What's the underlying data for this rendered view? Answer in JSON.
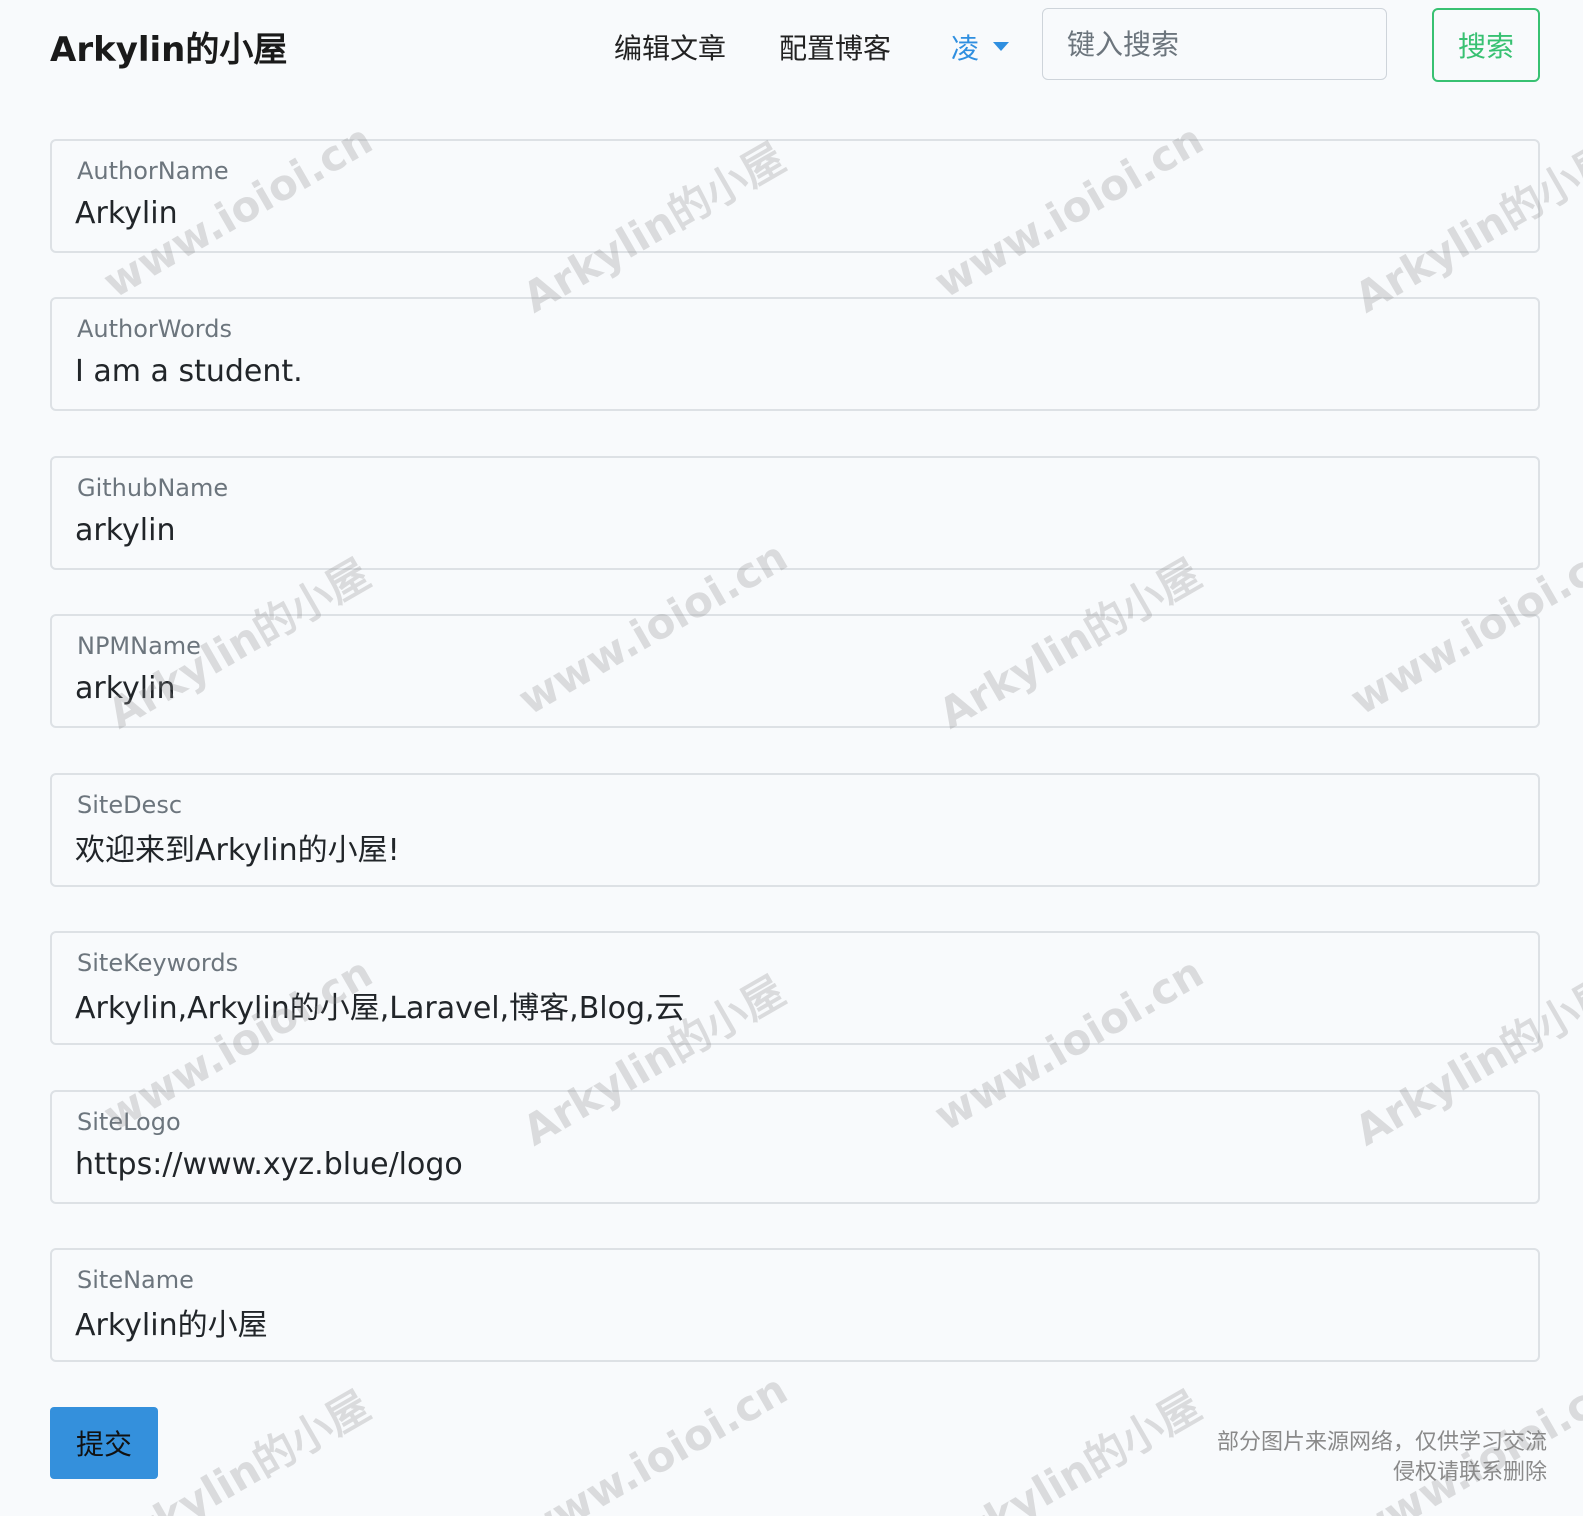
{
  "navbar": {
    "brand": "Arkylin的小屋",
    "links": [
      {
        "label": "编辑文章"
      },
      {
        "label": "配置博客"
      }
    ],
    "user_menu": "凌",
    "search": {
      "placeholder": "键入搜索",
      "button_label": "搜索"
    }
  },
  "form": {
    "fields": [
      {
        "label": "AuthorName",
        "value": "Arkylin"
      },
      {
        "label": "AuthorWords",
        "value": "I am a student."
      },
      {
        "label": "GithubName",
        "value": "arkylin"
      },
      {
        "label": "NPMName",
        "value": "arkylin"
      },
      {
        "label": "SiteDesc",
        "value": "欢迎来到Arkylin的小屋!"
      },
      {
        "label": "SiteKeywords",
        "value": "Arkylin,Arkylin的小屋,Laravel,博客,Blog,云"
      },
      {
        "label": "SiteLogo",
        "value": "https://www.xyz.blue/logo"
      },
      {
        "label": "SiteName",
        "value": "Arkylin的小屋"
      }
    ],
    "submit_label": "提交"
  },
  "footnote": {
    "line1": "部分图片来源网络，仅供学习交流",
    "line2": "侵权请联系删除"
  },
  "watermark": {
    "site": "www.ioioi.cn",
    "name": "Arkylin的小屋"
  },
  "colors": {
    "primary": "#3490dc",
    "success": "#38c172",
    "link_active": "#2f8fe0",
    "background": "#f8fafc"
  }
}
